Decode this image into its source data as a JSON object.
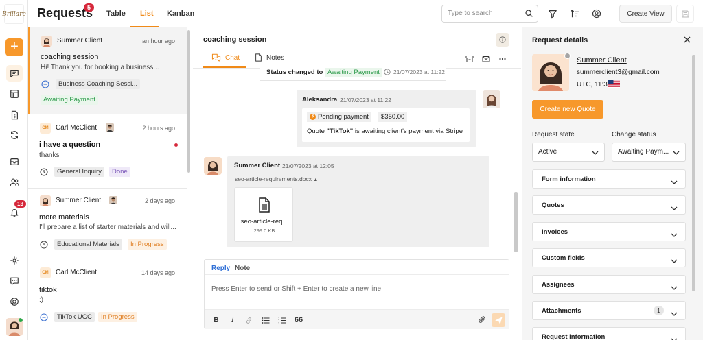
{
  "header": {
    "title": "Requests",
    "badge": "5",
    "views": [
      "Table",
      "List",
      "Kanban"
    ],
    "active_view": "List",
    "search_placeholder": "Type to search",
    "create_view_label": "Create View"
  },
  "rail": {
    "logo_text": "Brillare",
    "notifications_badge": "13",
    "icons": [
      "plus-icon",
      "chat-icon",
      "layout-icon",
      "invoice-icon",
      "sync-icon",
      "inbox-icon",
      "users-icon",
      "bell-icon",
      "settings-icon",
      "feedback-icon",
      "help-icon"
    ]
  },
  "requests": [
    {
      "client": "Summer Client",
      "time": "an hour ago",
      "subject": "coaching session",
      "preview": "Hi! Thank you for booking a business...",
      "service": "Business Coaching Sessi...",
      "status": "Awaiting Payment",
      "selected": true
    },
    {
      "client": "Carl McClient",
      "initials": "CM",
      "time": "2 hours ago",
      "subject": "i have a question",
      "preview": "thanks",
      "service": "General Inquiry",
      "status": "Done",
      "unread": true
    },
    {
      "client": "Summer Client",
      "time": "2 days ago",
      "subject": "more materials",
      "preview": "I'll prepare a list of starter materials and will...",
      "service": "Educational Materials",
      "status": "In Progress"
    },
    {
      "client": "Carl McClient",
      "initials": "CM",
      "time": "14 days ago",
      "subject": "tiktok",
      "preview": ":)",
      "service": "TikTok UGC",
      "status": "In Progress"
    }
  ],
  "chat": {
    "title": "coaching session",
    "tabs": [
      "Chat",
      "Notes"
    ],
    "active_tab": "Chat",
    "status_change": {
      "label": "Status changed to",
      "value": "Awaiting Payment",
      "time": "21/07/2023 at 11:22"
    },
    "outgoing": {
      "author": "Aleksandra",
      "time": "21/07/2023 at 11:22",
      "badge": "Pending payment",
      "amount": "$350.00",
      "text_prefix": "Quote ",
      "quote_name": "\"TikTok\"",
      "text_suffix": " is awaiting client's payment via Stripe"
    },
    "incoming": {
      "author": "Summer Client",
      "time": "21/07/2023 at 12:05",
      "file_header": "seo-article-requirements.docx",
      "file_name": "seo-article-req...",
      "file_size": "299.0 KB"
    },
    "composer": {
      "tabs": [
        "Reply",
        "Note"
      ],
      "active_tab": "Reply",
      "placeholder": "Press Enter to send or Shift + Enter to create a new line"
    }
  },
  "details": {
    "title": "Request details",
    "client_name": "Summer Client",
    "email": "summerclient3@gmail.com",
    "timezone": "UTC, 11:33",
    "create_quote_label": "Create new Quote",
    "request_state_label": "Request state",
    "request_state_value": "Active",
    "change_status_label": "Change status",
    "change_status_value": "Awaiting Paym...",
    "sections": [
      {
        "label": "Form information"
      },
      {
        "label": "Quotes"
      },
      {
        "label": "Invoices"
      },
      {
        "label": "Custom fields"
      },
      {
        "label": "Assignees"
      },
      {
        "label": "Attachments",
        "count": "1"
      },
      {
        "label": "Request information"
      }
    ]
  },
  "colors": {
    "accent": "#f7982b",
    "badge_red": "#d6283b",
    "status_green": "#2c9a4a",
    "link_blue": "#2f6fd6"
  }
}
